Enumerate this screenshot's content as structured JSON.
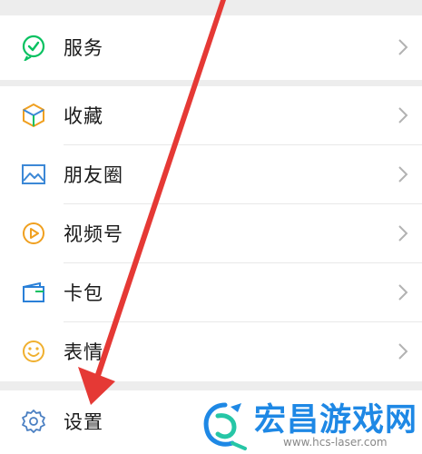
{
  "menu": {
    "items": [
      {
        "label": "服务",
        "icon": "service-icon"
      },
      {
        "label": "收藏",
        "icon": "favorites-cube-icon"
      },
      {
        "label": "朋友圈",
        "icon": "moments-image-icon"
      },
      {
        "label": "视频号",
        "icon": "channels-play-icon"
      },
      {
        "label": "卡包",
        "icon": "card-wallet-icon"
      },
      {
        "label": "表情",
        "icon": "emoji-face-icon"
      },
      {
        "label": "设置",
        "icon": "gear-icon"
      }
    ]
  },
  "watermark": {
    "title": "宏昌游戏网",
    "url": "www.hcs-laser.com"
  },
  "colors": {
    "background": "#ededed",
    "row": "#ffffff",
    "arrow": "#e53935",
    "service_icon": "#07c160",
    "cube_icon": "#f0a020",
    "image_icon": "#3c88d6",
    "play_icon": "#f0a020",
    "card_icon": "#2a80d8",
    "emoji_icon": "#f0b030",
    "gear_icon": "#4a7fc2",
    "watermark_blue": "#1e88e5"
  }
}
